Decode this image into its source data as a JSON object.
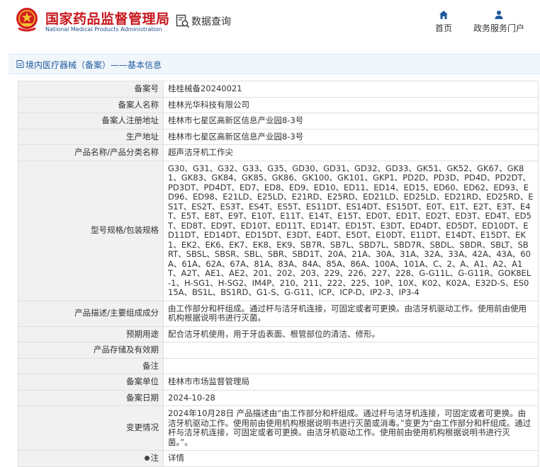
{
  "header": {
    "brand_cn": "国家药品监督管理局",
    "brand_en": "National Medical Products Administration",
    "query_label": "数据查询",
    "nav": [
      {
        "label": "首页",
        "icon": "home-icon"
      },
      {
        "label": "政务服务门户",
        "icon": "user-icon"
      }
    ]
  },
  "breadcrumb": "境内医疗器械（备案）——基本信息",
  "fields": {
    "record_no": {
      "label": "备案号",
      "value": "桂桂械备20240021"
    },
    "registrant": {
      "label": "备案人名称",
      "value": "桂林光华科技有限公司"
    },
    "reg_address": {
      "label": "备案人注册地址",
      "value": "桂林市七星区高新区信息产业园8-3号"
    },
    "prod_address": {
      "label": "生产地址",
      "value": "桂林市七星区高新区信息产业园8-3号"
    },
    "product_name": {
      "label": "产品名称/产品分类名称",
      "value": "超声洁牙机工作尖"
    },
    "models": {
      "label": "型号规格/包装规格",
      "value": "G30、G31、G32、G33、G35、GD30、GD31、GD32、GD33、GK51、GK52、GK67、GK81、GK83、GK84、GK85、GK86、GK100、GK101、GKP1、PD2D、PD3D、PD4D、PD2DT、PD3DT、PD4DT、ED7、ED8、ED9、ED10、ED11、ED14、ED15、ED60、ED62、ED93、ED96、ED98、E21LD、E25LD、E21RD、E25RD、ED21LD、ED25LD、ED21RD、ED25RD、ES1T、ES2T、ES3T、ES4T、ES5T、ES11DT、ES14DT、ES15DT、E0T、E1T、E2T、E3T、E4T、E5T、E8T、E9T、E10T、E11T、E14T、E15T、ED0T、ED1T、ED2T、ED3T、ED4T、ED5T、ED8T、ED9T、ED10T、ED11T、ED14T、ED15T、E3DT、ED4DT、ED5DT、ED10DT、ED11DT、ED14DT、ED15DT、E3DT、E4DT、E5DT、E10DT、E11DT、E14DT、E15DT、EK1、EK2、EK6、EK7、EK8、EK9、SB7R、SB7L、SBD7L、SBD7R、SBDL、SBDR、SBLT、SBRT、SBSL、SBSR、SBL、SBR、SBD1T、20A、21A、30A、31A、32A、33A、42A、43A、60A、61A、62A、67A、81A、83A、84A、85A、86A、100A、101A、C、2、A、A1、A2、A1T、A2T、AE1、AE2、201、202、203、229、226、227、228、G-G11L、G-G11R、GOK8EL-1、H-SG1、H-SG2、IM4P、210、211、222、225、10P、10X、K02、K02A、E32D-S、ES015A、BS1L、BS1RD、G1-S、G-G11、ICP、ICP-D、IP2-3、IP3-4"
    },
    "description": {
      "label": "产品描述/主要组成成分",
      "value": "由工作部分和杆组成。通过杆与洁牙机连接，可固定或者可更换。由洁牙机驱动工作。使用前由使用机构根据说明书进行灭菌。"
    },
    "intended_use": {
      "label": "预期用途",
      "value": "配合洁牙机使用，用于牙齿表面、根管部位的清洁、修形。"
    },
    "storage": {
      "label": "产品存储及有效期",
      "value": ""
    },
    "remarks": {
      "label": "备注",
      "value": ""
    },
    "authority": {
      "label": "备案单位",
      "value": "桂林市市场监督管理局"
    },
    "record_date": {
      "label": "备案日期",
      "value": "2024-10-28"
    },
    "changes": {
      "label": "变更情况",
      "value": "2024年10月28日 产品描述由“由工作部分和杆组成。通过杆与洁牙机连接，可固定或者可更换。由洁牙机驱动工作。使用前由使用机构根据说明书进行灭菌或消毒。”变更为“由工作部分和杆组成。通过杆与洁牙机连接，可固定或者可更换。由洁牙机驱动工作。使用前由使用机构根据说明书进行灭菌。”。"
    },
    "note": {
      "label": "注",
      "value": "详情"
    }
  },
  "colors": {
    "brand_red": "#c8161d",
    "brand_blue": "#1f4e8c",
    "link": "#2a6eb8"
  }
}
